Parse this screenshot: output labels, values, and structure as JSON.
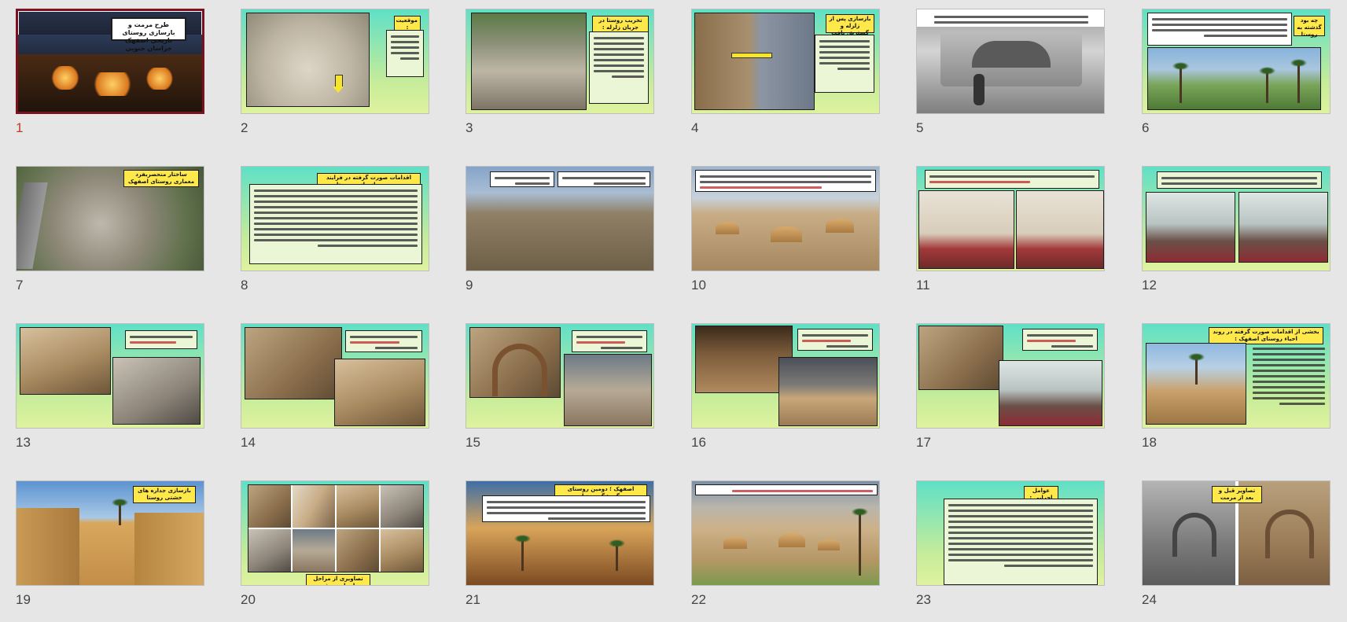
{
  "slide_sorter": {
    "selected_slide": 1,
    "slides": [
      {
        "number": "1",
        "title": "طرح مرمت و بازسازی روستای تاریخی اصفهک خراسان جنوبی"
      },
      {
        "number": "2",
        "title": "موقعیت :"
      },
      {
        "number": "3",
        "title": "تخریب روستا در جریان زلزله :"
      },
      {
        "number": "4",
        "title": "بازسازی پس از زلزله و گسترش بافت تاریخی"
      },
      {
        "number": "5",
        "title": ""
      },
      {
        "number": "6",
        "title": "چه بود گذشته به روستا"
      },
      {
        "number": "7",
        "title": "ساختار منحصربفرد معماری روستای اصفهک"
      },
      {
        "number": "8",
        "title": "اقدامات صورت گرفته در فرایند مرمت و بازسازی روستا"
      },
      {
        "number": "9",
        "title": ""
      },
      {
        "number": "10",
        "title": ""
      },
      {
        "number": "11",
        "title": ""
      },
      {
        "number": "12",
        "title": ""
      },
      {
        "number": "13",
        "title": ""
      },
      {
        "number": "14",
        "title": ""
      },
      {
        "number": "15",
        "title": ""
      },
      {
        "number": "16",
        "title": ""
      },
      {
        "number": "17",
        "title": ""
      },
      {
        "number": "18",
        "title": "بخشی از اقدامات صورت گرفته در روند احیاء روستای اصفهک :"
      },
      {
        "number": "19",
        "title": "بازسازی جداره های خشتی روستا"
      },
      {
        "number": "20",
        "title": "تصاویری از مراحل اجرای پروژه"
      },
      {
        "number": "21",
        "title": "اصفهک ؛ دومین روستای گردشگری دنیا"
      },
      {
        "number": "22",
        "title": ""
      },
      {
        "number": "23",
        "title": "عوامل اجرایی :"
      },
      {
        "number": "24",
        "title": "تصاویر قبل و بعد از مرمت"
      }
    ]
  },
  "colors": {
    "background": "#e6e6e6",
    "selection_border": "#7b1020",
    "selected_number": "#c0392b",
    "title_tag": "#ffe94a",
    "slide_gradient_top": "#5fe0c6",
    "slide_gradient_bottom": "#dff29e"
  }
}
